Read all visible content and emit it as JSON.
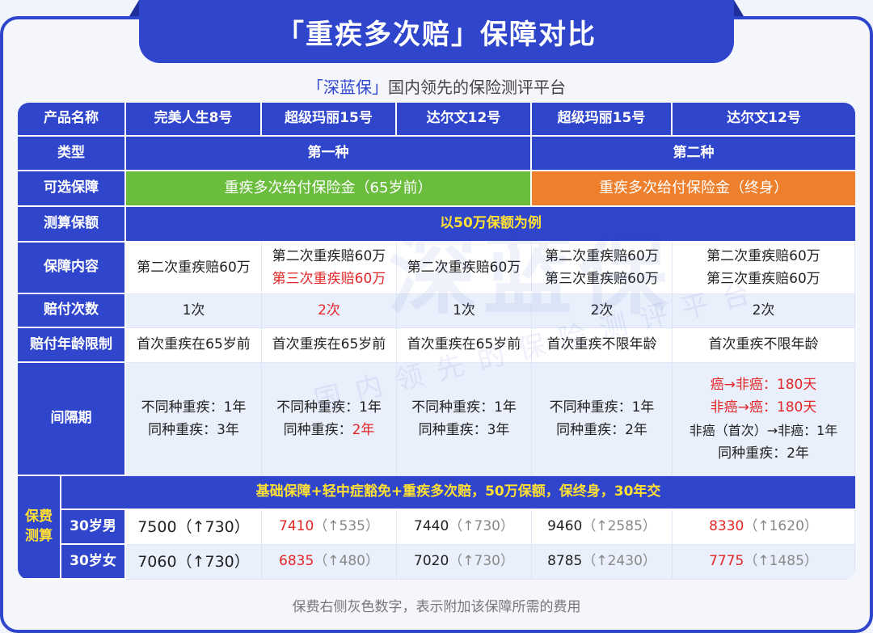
{
  "title": "「重疾多次赔」保障对比",
  "subtitle": {
    "brand": "「深蓝保」",
    "rest": "国内领先的保险测评平台"
  },
  "watermark": {
    "big": "深蓝保",
    "small": "国内领先的保险测评平台"
  },
  "table": {
    "row_labels": {
      "product": "产品名称",
      "type": "类型",
      "optional": "可选保障",
      "sum_insured": "测算保额",
      "content": "保障内容",
      "times": "赔付次数",
      "age_limit": "赔付年龄限制",
      "interval": "间隔期",
      "premium_calc": "保费测算",
      "male30": "30岁男",
      "female30": "30岁女"
    },
    "products": [
      "完美人生8号",
      "超级玛丽15号",
      "达尔文12号",
      "超级玛丽15号",
      "达尔文12号"
    ],
    "types": [
      "第一种",
      "第二种"
    ],
    "optional": [
      "重疾多次给付保险金（65岁前）",
      "重疾多次给付保险金（终身）"
    ],
    "sum_insured": "以50万保额为例",
    "content": [
      [
        "第二次重疾赔60万"
      ],
      [
        "第二次重疾赔60万",
        "第三次重疾赔60万"
      ],
      [
        "第二次重疾赔60万"
      ],
      [
        "第二次重疾赔60万",
        "第三次重疾赔60万"
      ],
      [
        "第二次重疾赔60万",
        "第三次重疾赔60万"
      ]
    ],
    "times": [
      "1次",
      "2次",
      "1次",
      "2次",
      "2次"
    ],
    "age_limit": [
      "首次重疾在65岁前",
      "首次重疾在65岁前",
      "首次重疾在65岁前",
      "首次重疾不限年龄",
      "首次重疾不限年龄"
    ],
    "interval": [
      [
        "不同种重疾：1年",
        "同种重疾：3年"
      ],
      [
        "不同种重疾：1年",
        "同种重疾：",
        "2年"
      ],
      [
        "不同种重疾：1年",
        "同种重疾：3年"
      ],
      [
        "不同种重疾：1年",
        "同种重疾：2年"
      ],
      [
        "癌→非癌：180天",
        "非癌→癌：180天",
        "非癌（首次）→非癌：1年",
        "同种重疾：2年"
      ]
    ],
    "premium_basis": "基础保障+轻中症豁免+重疾多次赔，50万保额，保终身，30年交",
    "male": [
      {
        "price": "7500",
        "extra": "（↑730）"
      },
      {
        "price": "7410",
        "extra": "（↑535）"
      },
      {
        "price": "7440",
        "extra": "（↑730）"
      },
      {
        "price": "9460",
        "extra": "（↑2585）"
      },
      {
        "price": "8330",
        "extra": "（↑1620）"
      }
    ],
    "female": [
      {
        "price": "7060",
        "extra": "（↑730）"
      },
      {
        "price": "6835",
        "extra": "（↑480）"
      },
      {
        "price": "7020",
        "extra": "（↑730）"
      },
      {
        "price": "8785",
        "extra": "（↑2430）"
      },
      {
        "price": "7775",
        "extra": "（↑1485）"
      }
    ]
  },
  "footnote": "保费右侧灰色数字，表示附加该保障所需的费用",
  "colors": {
    "blue": "#2f45cc",
    "green": "#6bbd3d",
    "orange": "#ee7f2d",
    "red": "#e32626",
    "yellow": "#ffe033"
  }
}
